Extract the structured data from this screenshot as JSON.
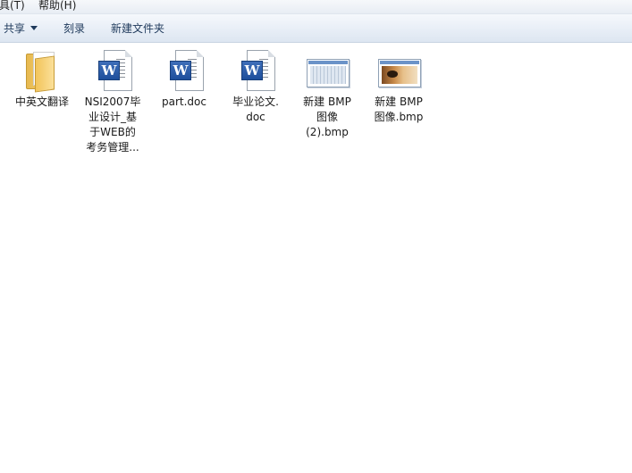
{
  "menubar": {
    "items": [
      "具(T)",
      "帮助(H)"
    ]
  },
  "toolbar": {
    "share_label": "共享",
    "burn_label": "刻录",
    "new_folder_label": "新建文件夹"
  },
  "files": [
    {
      "type": "folder",
      "icon": "folder-icon",
      "label_lines": [
        "中英文翻译"
      ]
    },
    {
      "type": "doc",
      "icon": "word-doc-icon",
      "label_lines": [
        "NSI2007毕",
        "业设计_基",
        "于WEB的",
        "考务管理..."
      ]
    },
    {
      "type": "doc",
      "icon": "word-doc-icon",
      "label_lines": [
        "part.doc"
      ]
    },
    {
      "type": "doc",
      "icon": "word-doc-icon",
      "label_lines": [
        "毕业论文.",
        "doc"
      ]
    },
    {
      "type": "bmp",
      "icon": "bmp-thumbnail-icon",
      "label_lines": [
        "新建 BMP",
        "图像",
        "(2).bmp"
      ]
    },
    {
      "type": "bmp",
      "icon": "bmp-thumbnail-icon",
      "label_lines": [
        "新建 BMP",
        "图像.bmp"
      ]
    }
  ],
  "colors": {
    "toolbar_text": "#1e395b",
    "word_blue": "#2b5ca8",
    "folder_yellow": "#f2c45a"
  }
}
